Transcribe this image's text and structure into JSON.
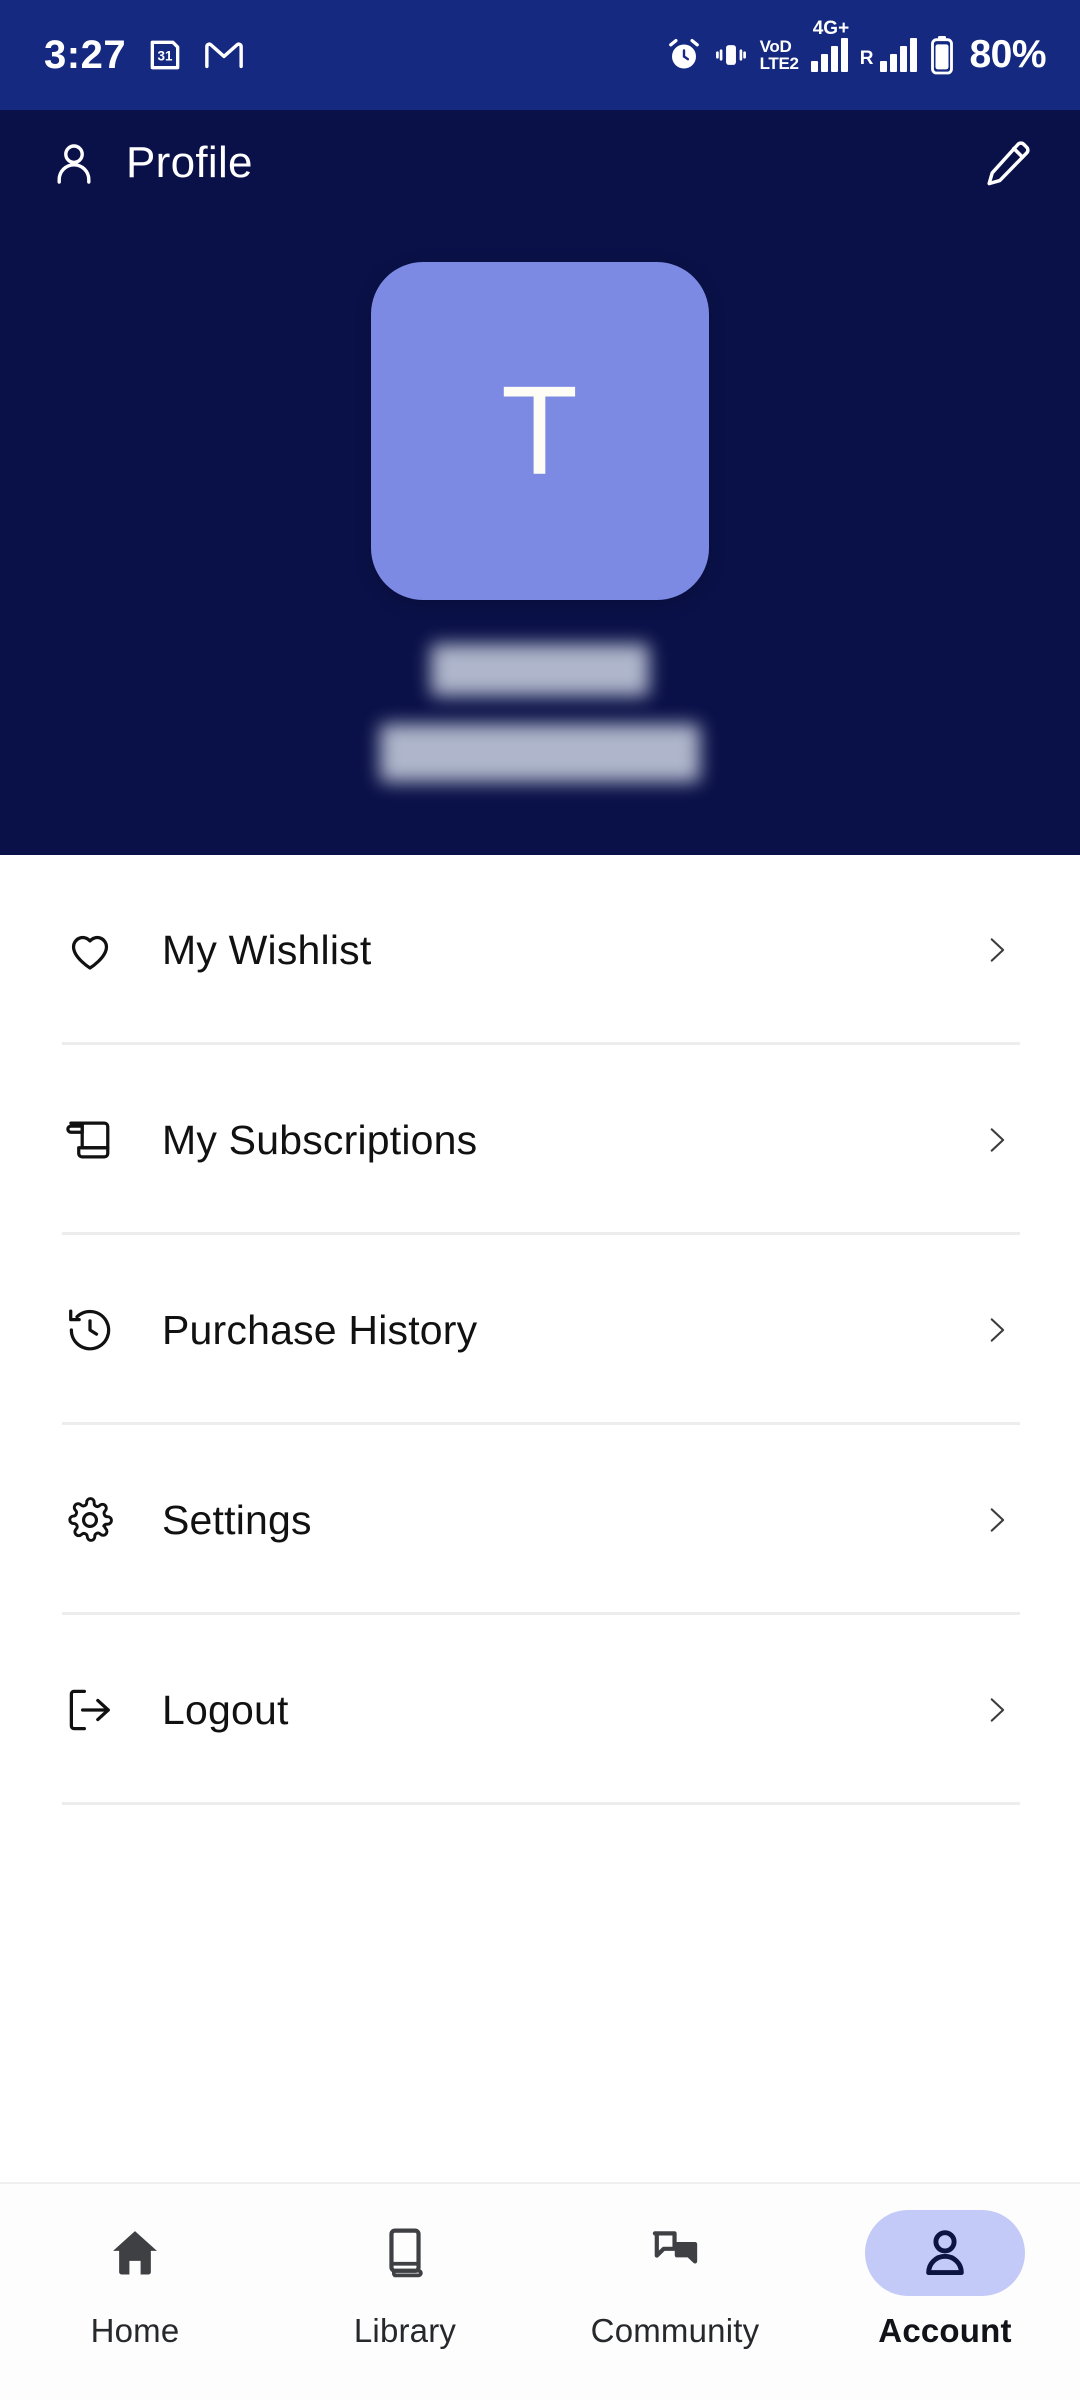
{
  "status_bar": {
    "time": "3:27",
    "left_icons": [
      "calendar-31-icon",
      "gmail-icon"
    ],
    "calendar_day": "31",
    "gmail_glyph": "M",
    "right_icons": [
      "alarm-icon",
      "vibrate-icon",
      "volte-icon",
      "signal-4g-icon",
      "signal-roaming-icon",
      "battery-icon"
    ],
    "volte_line1": "VoD",
    "volte_line2": "LTE2",
    "network_label": "4G",
    "network_plus": "+",
    "roaming_label": "R",
    "battery_percent": "80%",
    "background_color": "#14297F"
  },
  "header": {
    "title": "Profile",
    "profile_icon": "person-icon",
    "edit_icon": "pencil-edit-icon",
    "background_color": "#0A1148"
  },
  "profile": {
    "avatar_initial": "T",
    "avatar_color": "#7C8AE3",
    "name_redacted": true,
    "email_redacted": true
  },
  "menu": {
    "items": [
      {
        "label": "My Wishlist",
        "icon": "heart-icon",
        "chevron": "chevron-right-icon"
      },
      {
        "label": "My Subscriptions",
        "icon": "scroll-receipt-icon",
        "chevron": "chevron-right-icon"
      },
      {
        "label": "Purchase History",
        "icon": "history-clock-icon",
        "chevron": "chevron-right-icon"
      },
      {
        "label": "Settings",
        "icon": "gear-icon",
        "chevron": "chevron-right-icon"
      },
      {
        "label": "Logout",
        "icon": "logout-icon",
        "chevron": "chevron-right-icon"
      }
    ]
  },
  "bottom_nav": {
    "active_index": 3,
    "active_pill_color": "#C4CAF8",
    "items": [
      {
        "label": "Home",
        "icon": "home-icon"
      },
      {
        "label": "Library",
        "icon": "book-icon"
      },
      {
        "label": "Community",
        "icon": "chat-bubbles-icon"
      },
      {
        "label": "Account",
        "icon": "person-icon"
      }
    ]
  }
}
